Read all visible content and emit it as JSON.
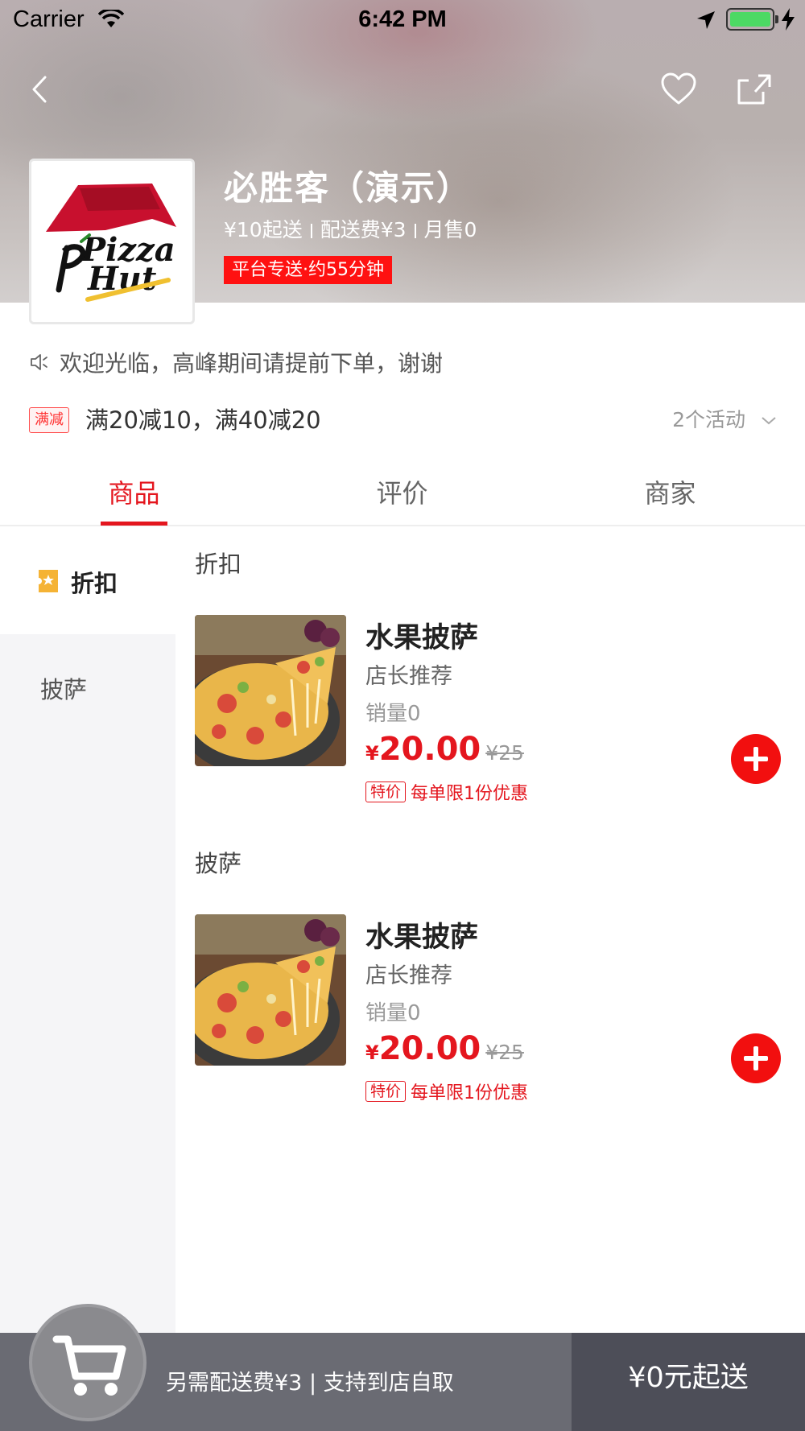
{
  "status_bar": {
    "carrier": "Carrier",
    "time": "6:42 PM"
  },
  "nav": {
    "back_icon": "back-chevron",
    "favorite_icon": "heart-outline",
    "share_icon": "share-box"
  },
  "shop": {
    "name": "必胜客（演示）",
    "min_order": "¥10起送",
    "delivery_fee": "配送费¥3",
    "monthly_sales": "月售0",
    "delivery_tag": "平台专送·约55分钟",
    "logo_text_1": "Pizza",
    "logo_text_2": "Hut"
  },
  "notice": "欢迎光临，高峰期间请提前下单，谢谢",
  "promotion": {
    "tag": "满减",
    "text": "满20减10，满40减20",
    "more": "2个活动"
  },
  "tabs": [
    {
      "label": "商品",
      "active": true
    },
    {
      "label": "评价",
      "active": false
    },
    {
      "label": "商家",
      "active": false
    }
  ],
  "categories": [
    {
      "label": "折扣",
      "active": true
    },
    {
      "label": "披萨",
      "active": false
    }
  ],
  "sections": [
    {
      "title": "折扣",
      "products": [
        {
          "name": "水果披萨",
          "desc": "店长推荐",
          "sales": "销量0",
          "currency": "¥",
          "price": "20.00",
          "orig_price": "¥25",
          "deal_tag": "特价",
          "deal_text": "每单限1份优惠"
        }
      ]
    },
    {
      "title": "披萨",
      "products": [
        {
          "name": "水果披萨",
          "desc": "店长推荐",
          "sales": "销量0",
          "currency": "¥",
          "price": "20.00",
          "orig_price": "¥25",
          "deal_tag": "特价",
          "deal_text": "每单限1份优惠"
        }
      ]
    }
  ],
  "cart": {
    "info": "另需配送费¥3 | 支持到店自取",
    "checkout": "¥0元起送"
  },
  "colors": {
    "accent": "#e4161e",
    "delivery_tag_bg": "#ff1111",
    "cart_bar": "#6a6b73",
    "checkout_bg": "#4d4e58"
  }
}
